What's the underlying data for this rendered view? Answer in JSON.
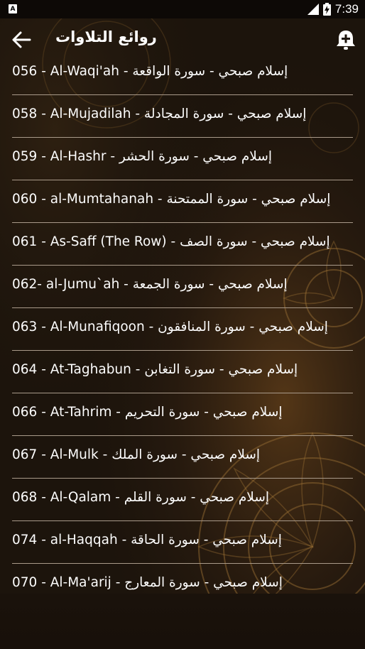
{
  "status_bar": {
    "time": "7:39",
    "left_icon": "A"
  },
  "app_bar": {
    "title": "روائع التلاوات",
    "back_icon": "arrow-left-icon",
    "action_icon": "bell-plus-icon"
  },
  "items": [
    {
      "label": "056 - Al-Waqi'ah - إسلام صبحي - سورة الواقعة"
    },
    {
      "label": "058 - Al-Mujadilah - إسلام صبحي - سورة المجادلة"
    },
    {
      "label": "059 - Al-Hashr - إسلام صبحي - سورة الحشر"
    },
    {
      "label": "060 - al-Mumtahanah -  إسلام صبحي - سورة الممتحنة"
    },
    {
      "label": "061 - As-Saff (The Row) - إسلام صبحي - سورة الصف"
    },
    {
      "label": "062- al-Jumu`ah -  إسلام صبحي - سورة الجمعة"
    },
    {
      "label": "063 - Al-Munafiqoon - إسلام صبحي - سورة المنافقون"
    },
    {
      "label": "064 - At-Taghabun - إسلام صبحي - سورة التغابن"
    },
    {
      "label": "066 - At-Tahrim - إسلام صبحي - سورة التحريم"
    },
    {
      "label": "067 - Al-Mulk - إسلام صبحي - سورة الملك"
    },
    {
      "label": "068 - Al-Qalam - إسلام صبحي - سورة القلم"
    },
    {
      "label": "074 - al-Haqqah -  إسلام صبحي - سورة الحاقة"
    },
    {
      "label": "070 - Al-Ma'arij - إسلام صبحي - سورة المعارج"
    }
  ]
}
